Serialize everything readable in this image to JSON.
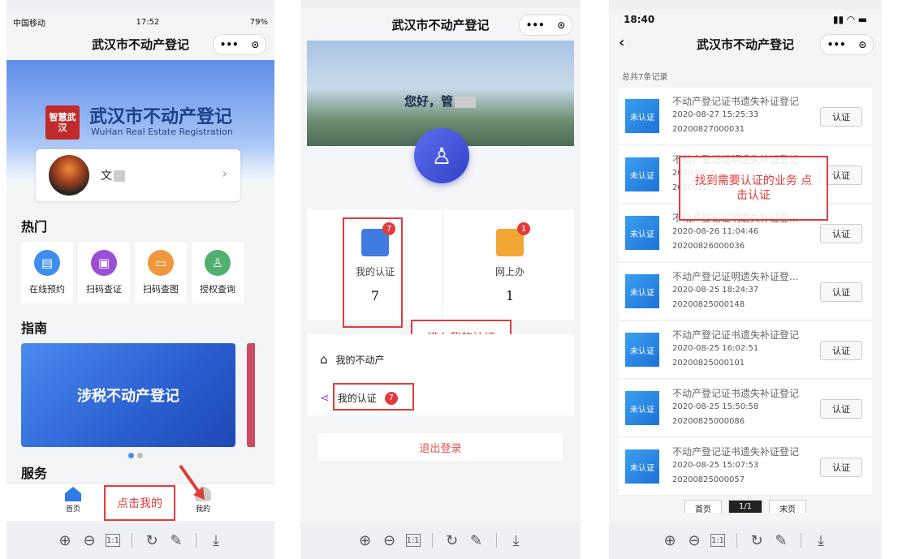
{
  "colors": {
    "accent": "#e23b3b",
    "primary_blue": "#2a5fd0",
    "avatar_purple": "#4a55e0",
    "logout": "#e0574a"
  },
  "toolbar": {
    "icons": [
      "zoom-in-icon",
      "zoom-out-icon",
      "actual-size-icon",
      "rotate-icon",
      "edit-icon",
      "download-icon"
    ],
    "actual_size": "1:1"
  },
  "panel1": {
    "status": {
      "carrier": "中国移动",
      "time": "17:52",
      "battery": "79%"
    },
    "title": "武汉市不动产登记",
    "banner": {
      "seal": "智慧武汉",
      "title": "武汉市不动产登记",
      "subtitle": "WuHan Real Estate Registration"
    },
    "user": {
      "name": "文"
    },
    "section_hot": "热门",
    "tiles": [
      {
        "label": "在线预约",
        "color": "#3d8ef0"
      },
      {
        "label": "扫码查证",
        "color": "#9a4fd6"
      },
      {
        "label": "扫码查图",
        "color": "#f0963c"
      },
      {
        "label": "授权查询",
        "color": "#4fb070"
      }
    ],
    "section_guide": "指南",
    "guide_card": "涉税不动产登记",
    "section_service": "服务",
    "tabs": {
      "home": "首页",
      "mine": "我的"
    },
    "annotation": "点击我的"
  },
  "panel2": {
    "title": "武汉市不动产登记",
    "greeting": "您好，管",
    "stats": [
      {
        "label": "我的认证",
        "value": "7",
        "badge": "7"
      },
      {
        "label": "网上办",
        "value": "1",
        "badge": "1"
      }
    ],
    "menu": [
      {
        "label": "我的不动产"
      },
      {
        "label": "我的认证",
        "badge": "7"
      }
    ],
    "annotation": "进入我的认证",
    "logout": "退出登录"
  },
  "panel3": {
    "status": {
      "time": "18:40"
    },
    "title": "武汉市不动产登记",
    "count": "总共7条记录",
    "annotation": "找到需要认证的业务 点击认证",
    "records": [
      {
        "badge": "未认证",
        "title": "不动产登记证书遗失补证登记",
        "date": "2020-08-27 15:25:33",
        "no": "20200827000031",
        "button": "认证"
      },
      {
        "badge": "未认证",
        "title": "不动产登记证明遗失补证登记",
        "date": "2020-08-2",
        "no": "2020082",
        "button": "认证"
      },
      {
        "badge": "未认证",
        "title": "不动产登记证明遗失补证登...",
        "date": "2020-08-26 11:04:46",
        "no": "20200826000036",
        "button": "认证"
      },
      {
        "badge": "未认证",
        "title": "不动产登记证明遗失补证登...",
        "date": "2020-08-25 18:24:37",
        "no": "20200825000148",
        "button": "认证"
      },
      {
        "badge": "未认证",
        "title": "不动产登记证书遗失补证登记",
        "date": "2020-08-25 16:02:51",
        "no": "20200825000101",
        "button": "认证"
      },
      {
        "badge": "未认证",
        "title": "不动产登记证书遗失补证登记",
        "date": "2020-08-25 15:50:58",
        "no": "20200825000086",
        "button": "认证"
      },
      {
        "badge": "未认证",
        "title": "不动产登记证书遗失补证登记",
        "date": "2020-08-25 15:07:53",
        "no": "20200825000057",
        "button": "认证"
      }
    ],
    "pager": {
      "first": "首页",
      "page": "1/1",
      "last": "末页"
    }
  }
}
